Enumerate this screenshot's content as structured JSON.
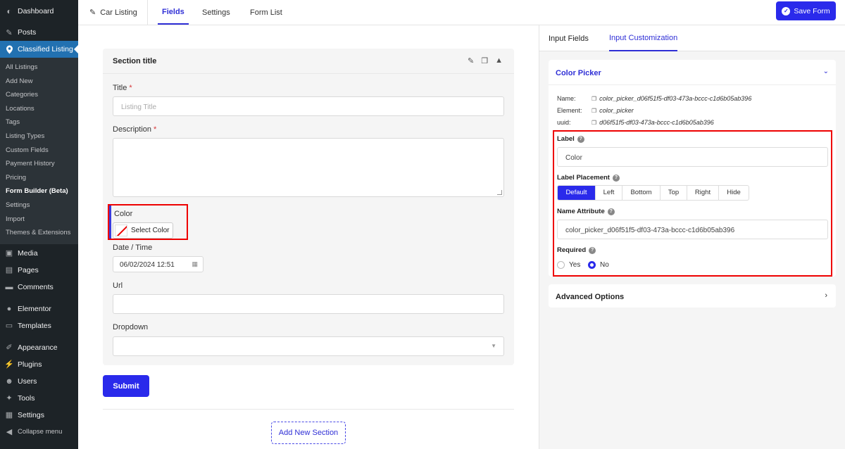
{
  "sidebar": {
    "dashboard": "Dashboard",
    "posts": "Posts",
    "active_menu": "Classified Listing",
    "submenu": [
      "All Listings",
      "Add New",
      "Categories",
      "Locations",
      "Tags",
      "Listing Types",
      "Custom Fields",
      "Payment History",
      "Pricing",
      "Form Builder (Beta)",
      "Settings",
      "Import",
      "Themes & Extensions"
    ],
    "current_submenu": "Form Builder (Beta)",
    "media": "Media",
    "pages": "Pages",
    "comments": "Comments",
    "elementor": "Elementor",
    "templates": "Templates",
    "appearance": "Appearance",
    "plugins": "Plugins",
    "users": "Users",
    "tools": "Tools",
    "settings": "Settings",
    "collapse": "Collapse menu"
  },
  "topbar": {
    "form_title": "Car Listing",
    "tabs": [
      "Fields",
      "Settings",
      "Form List"
    ],
    "active_tab": "Fields",
    "save_label": "Save Form"
  },
  "form": {
    "section_title": "Section title",
    "title_label": "Title",
    "title_placeholder": "Listing Title",
    "description_label": "Description",
    "required_mark": "*",
    "color_label": "Color",
    "select_color": "Select Color",
    "datetime_label": "Date / Time",
    "datetime_value": "06/02/2024 12:51",
    "url_label": "Url",
    "dropdown_label": "Dropdown",
    "submit_label": "Submit",
    "add_section_label": "Add New Section"
  },
  "panel": {
    "tabs": [
      "Input Fields",
      "Input Customization"
    ],
    "active_tab": "Input Customization",
    "header": "Color Picker",
    "meta": {
      "name_label": "Name:",
      "name_value": "color_picker_d06f51f5-df03-473a-bccc-c1d6b05ab396",
      "element_label": "Element:",
      "element_value": "color_picker",
      "uuid_label": "uuid:",
      "uuid_value": "d06f51f5-df03-473a-bccc-c1d6b05ab396"
    },
    "label_title": "Label",
    "label_value": "Color",
    "placement_title": "Label Placement",
    "placement_options": [
      "Default",
      "Left",
      "Bottom",
      "Top",
      "Right",
      "Hide"
    ],
    "placement_selected": "Default",
    "name_attr_title": "Name Attribute",
    "name_attr_value": "color_picker_d06f51f5-df03-473a-bccc-c1d6b05ab396",
    "required_title": "Required",
    "required_yes": "Yes",
    "required_no": "No",
    "required_selected": "No",
    "advanced_label": "Advanced Options"
  },
  "colors": {
    "accent": "#2a2aeb",
    "sidebar_bg": "#1d2327",
    "sidebar_active": "#2271b1",
    "highlight_box": "#e00000"
  }
}
